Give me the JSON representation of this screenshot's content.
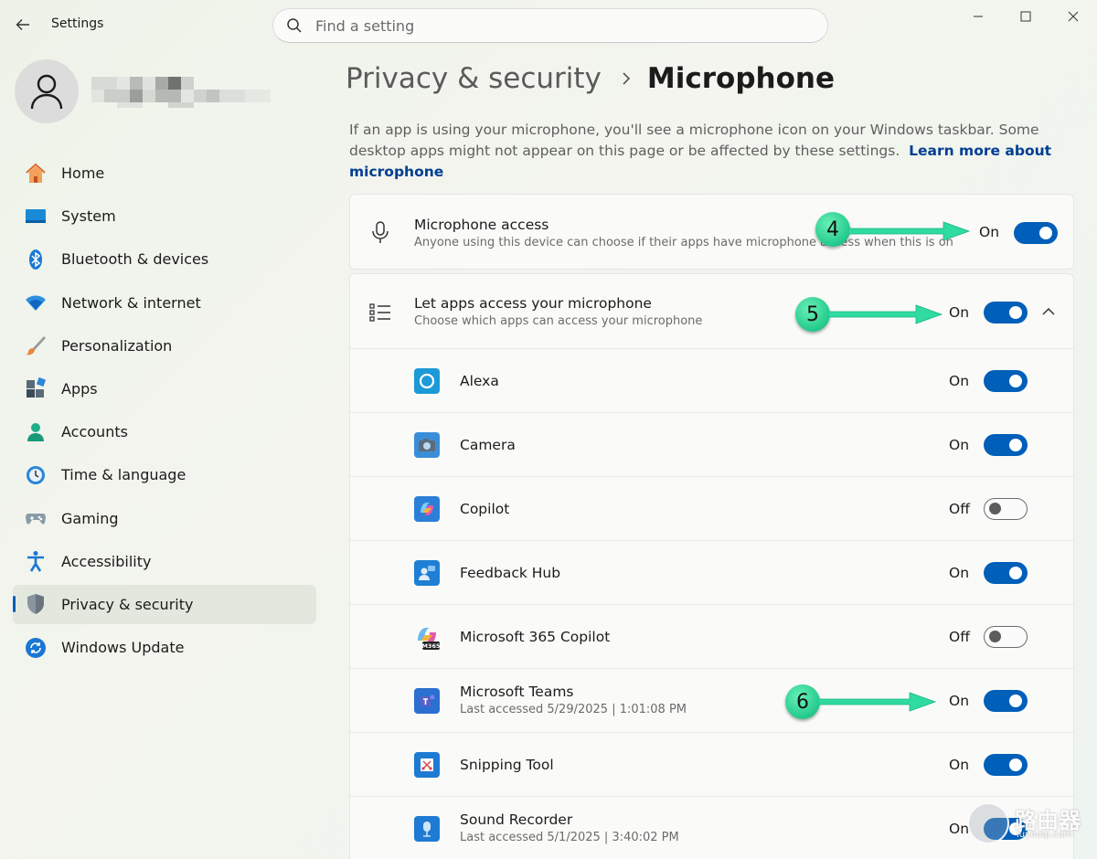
{
  "window": {
    "title": "Settings"
  },
  "search": {
    "placeholder": "Find a setting"
  },
  "nav": [
    {
      "label": "Home",
      "icon": "home-icon"
    },
    {
      "label": "System",
      "icon": "system-icon"
    },
    {
      "label": "Bluetooth & devices",
      "icon": "bluetooth-icon"
    },
    {
      "label": "Network & internet",
      "icon": "wifi-icon"
    },
    {
      "label": "Personalization",
      "icon": "brush-icon"
    },
    {
      "label": "Apps",
      "icon": "apps-icon"
    },
    {
      "label": "Accounts",
      "icon": "accounts-icon"
    },
    {
      "label": "Time & language",
      "icon": "clock-icon"
    },
    {
      "label": "Gaming",
      "icon": "gamepad-icon"
    },
    {
      "label": "Accessibility",
      "icon": "accessibility-icon"
    },
    {
      "label": "Privacy & security",
      "icon": "shield-icon",
      "active": true
    },
    {
      "label": "Windows Update",
      "icon": "update-icon"
    }
  ],
  "breadcrumb": {
    "parent": "Privacy & security",
    "current": "Microphone"
  },
  "description": {
    "text": "If an app is using your microphone, you'll see a microphone icon on your Windows taskbar. Some desktop apps might not appear on this page or be affected by these settings.",
    "link": "Learn more about microphone"
  },
  "microphone_access": {
    "title": "Microphone access",
    "subtitle": "Anyone using this device can choose if their apps have microphone access when this is on",
    "state": "On"
  },
  "let_apps": {
    "title": "Let apps access your microphone",
    "subtitle": "Choose which apps can access your microphone",
    "state": "On"
  },
  "apps": [
    {
      "name": "Alexa",
      "subtitle": "",
      "state": "On",
      "icon": "alexa-icon"
    },
    {
      "name": "Camera",
      "subtitle": "",
      "state": "On",
      "icon": "camera-icon"
    },
    {
      "name": "Copilot",
      "subtitle": "",
      "state": "Off",
      "icon": "copilot-icon"
    },
    {
      "name": "Feedback Hub",
      "subtitle": "",
      "state": "On",
      "icon": "feedback-hub-icon"
    },
    {
      "name": "Microsoft 365 Copilot",
      "subtitle": "",
      "state": "Off",
      "icon": "m365-copilot-icon",
      "badge": "M365"
    },
    {
      "name": "Microsoft Teams",
      "subtitle": "Last accessed 5/29/2025 | 1:01:08 PM",
      "state": "On",
      "icon": "teams-icon"
    },
    {
      "name": "Snipping Tool",
      "subtitle": "",
      "state": "On",
      "icon": "snipping-tool-icon"
    },
    {
      "name": "Sound Recorder",
      "subtitle": "Last accessed 5/1/2025 | 3:40:02 PM",
      "state": "On",
      "icon": "sound-recorder-icon"
    }
  ],
  "callouts": [
    "4",
    "5",
    "6"
  ],
  "watermark": {
    "text": "路由器",
    "sub": "luyouqi.com"
  },
  "colors": {
    "accent": "#005fb8",
    "callout": "#22c98a",
    "link": "#003e92"
  }
}
